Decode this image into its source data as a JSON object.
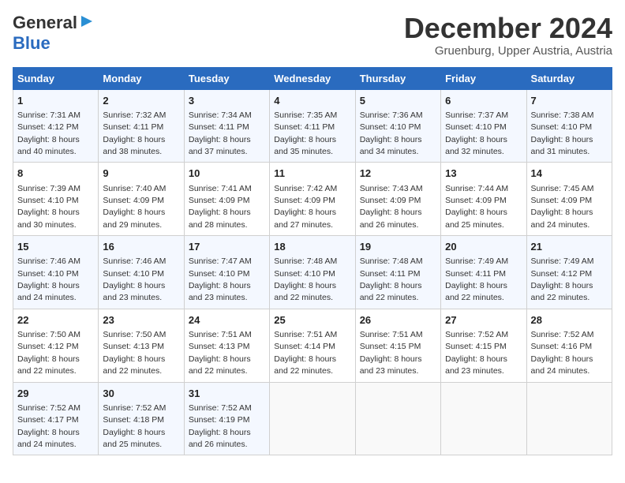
{
  "header": {
    "logo_line1": "General",
    "logo_line2": "Blue",
    "month_title": "December 2024",
    "subtitle": "Gruenburg, Upper Austria, Austria"
  },
  "days_of_week": [
    "Sunday",
    "Monday",
    "Tuesday",
    "Wednesday",
    "Thursday",
    "Friday",
    "Saturday"
  ],
  "weeks": [
    [
      {
        "day": "1",
        "sunrise": "Sunrise: 7:31 AM",
        "sunset": "Sunset: 4:12 PM",
        "daylight": "Daylight: 8 hours and 40 minutes."
      },
      {
        "day": "2",
        "sunrise": "Sunrise: 7:32 AM",
        "sunset": "Sunset: 4:11 PM",
        "daylight": "Daylight: 8 hours and 38 minutes."
      },
      {
        "day": "3",
        "sunrise": "Sunrise: 7:34 AM",
        "sunset": "Sunset: 4:11 PM",
        "daylight": "Daylight: 8 hours and 37 minutes."
      },
      {
        "day": "4",
        "sunrise": "Sunrise: 7:35 AM",
        "sunset": "Sunset: 4:11 PM",
        "daylight": "Daylight: 8 hours and 35 minutes."
      },
      {
        "day": "5",
        "sunrise": "Sunrise: 7:36 AM",
        "sunset": "Sunset: 4:10 PM",
        "daylight": "Daylight: 8 hours and 34 minutes."
      },
      {
        "day": "6",
        "sunrise": "Sunrise: 7:37 AM",
        "sunset": "Sunset: 4:10 PM",
        "daylight": "Daylight: 8 hours and 32 minutes."
      },
      {
        "day": "7",
        "sunrise": "Sunrise: 7:38 AM",
        "sunset": "Sunset: 4:10 PM",
        "daylight": "Daylight: 8 hours and 31 minutes."
      }
    ],
    [
      {
        "day": "8",
        "sunrise": "Sunrise: 7:39 AM",
        "sunset": "Sunset: 4:10 PM",
        "daylight": "Daylight: 8 hours and 30 minutes."
      },
      {
        "day": "9",
        "sunrise": "Sunrise: 7:40 AM",
        "sunset": "Sunset: 4:09 PM",
        "daylight": "Daylight: 8 hours and 29 minutes."
      },
      {
        "day": "10",
        "sunrise": "Sunrise: 7:41 AM",
        "sunset": "Sunset: 4:09 PM",
        "daylight": "Daylight: 8 hours and 28 minutes."
      },
      {
        "day": "11",
        "sunrise": "Sunrise: 7:42 AM",
        "sunset": "Sunset: 4:09 PM",
        "daylight": "Daylight: 8 hours and 27 minutes."
      },
      {
        "day": "12",
        "sunrise": "Sunrise: 7:43 AM",
        "sunset": "Sunset: 4:09 PM",
        "daylight": "Daylight: 8 hours and 26 minutes."
      },
      {
        "day": "13",
        "sunrise": "Sunrise: 7:44 AM",
        "sunset": "Sunset: 4:09 PM",
        "daylight": "Daylight: 8 hours and 25 minutes."
      },
      {
        "day": "14",
        "sunrise": "Sunrise: 7:45 AM",
        "sunset": "Sunset: 4:09 PM",
        "daylight": "Daylight: 8 hours and 24 minutes."
      }
    ],
    [
      {
        "day": "15",
        "sunrise": "Sunrise: 7:46 AM",
        "sunset": "Sunset: 4:10 PM",
        "daylight": "Daylight: 8 hours and 24 minutes."
      },
      {
        "day": "16",
        "sunrise": "Sunrise: 7:46 AM",
        "sunset": "Sunset: 4:10 PM",
        "daylight": "Daylight: 8 hours and 23 minutes."
      },
      {
        "day": "17",
        "sunrise": "Sunrise: 7:47 AM",
        "sunset": "Sunset: 4:10 PM",
        "daylight": "Daylight: 8 hours and 23 minutes."
      },
      {
        "day": "18",
        "sunrise": "Sunrise: 7:48 AM",
        "sunset": "Sunset: 4:10 PM",
        "daylight": "Daylight: 8 hours and 22 minutes."
      },
      {
        "day": "19",
        "sunrise": "Sunrise: 7:48 AM",
        "sunset": "Sunset: 4:11 PM",
        "daylight": "Daylight: 8 hours and 22 minutes."
      },
      {
        "day": "20",
        "sunrise": "Sunrise: 7:49 AM",
        "sunset": "Sunset: 4:11 PM",
        "daylight": "Daylight: 8 hours and 22 minutes."
      },
      {
        "day": "21",
        "sunrise": "Sunrise: 7:49 AM",
        "sunset": "Sunset: 4:12 PM",
        "daylight": "Daylight: 8 hours and 22 minutes."
      }
    ],
    [
      {
        "day": "22",
        "sunrise": "Sunrise: 7:50 AM",
        "sunset": "Sunset: 4:12 PM",
        "daylight": "Daylight: 8 hours and 22 minutes."
      },
      {
        "day": "23",
        "sunrise": "Sunrise: 7:50 AM",
        "sunset": "Sunset: 4:13 PM",
        "daylight": "Daylight: 8 hours and 22 minutes."
      },
      {
        "day": "24",
        "sunrise": "Sunrise: 7:51 AM",
        "sunset": "Sunset: 4:13 PM",
        "daylight": "Daylight: 8 hours and 22 minutes."
      },
      {
        "day": "25",
        "sunrise": "Sunrise: 7:51 AM",
        "sunset": "Sunset: 4:14 PM",
        "daylight": "Daylight: 8 hours and 22 minutes."
      },
      {
        "day": "26",
        "sunrise": "Sunrise: 7:51 AM",
        "sunset": "Sunset: 4:15 PM",
        "daylight": "Daylight: 8 hours and 23 minutes."
      },
      {
        "day": "27",
        "sunrise": "Sunrise: 7:52 AM",
        "sunset": "Sunset: 4:15 PM",
        "daylight": "Daylight: 8 hours and 23 minutes."
      },
      {
        "day": "28",
        "sunrise": "Sunrise: 7:52 AM",
        "sunset": "Sunset: 4:16 PM",
        "daylight": "Daylight: 8 hours and 24 minutes."
      }
    ],
    [
      {
        "day": "29",
        "sunrise": "Sunrise: 7:52 AM",
        "sunset": "Sunset: 4:17 PM",
        "daylight": "Daylight: 8 hours and 24 minutes."
      },
      {
        "day": "30",
        "sunrise": "Sunrise: 7:52 AM",
        "sunset": "Sunset: 4:18 PM",
        "daylight": "Daylight: 8 hours and 25 minutes."
      },
      {
        "day": "31",
        "sunrise": "Sunrise: 7:52 AM",
        "sunset": "Sunset: 4:19 PM",
        "daylight": "Daylight: 8 hours and 26 minutes."
      },
      null,
      null,
      null,
      null
    ]
  ]
}
